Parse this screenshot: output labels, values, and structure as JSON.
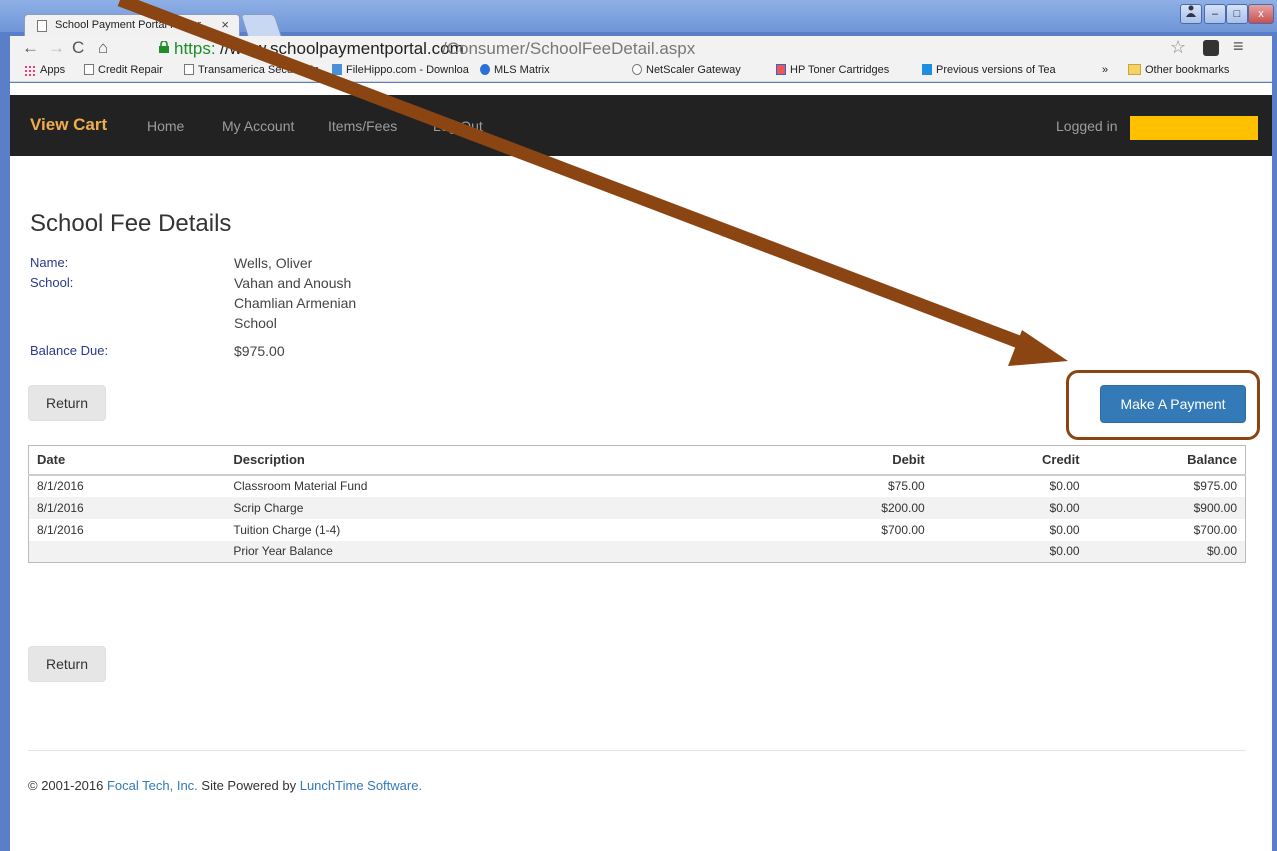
{
  "browser": {
    "tab_title": "School Payment Portal Power",
    "tab_close": "×",
    "url_scheme": "https:",
    "url_host": "//www.schoolpaymentportal.com",
    "url_path": "/Consumer/SchoolFeeDetail.aspx",
    "window_buttons": {
      "user": "👤",
      "minimize": "–",
      "maximize": "□",
      "close": "x"
    },
    "bookmarks": [
      {
        "label": "Apps",
        "icon": "apps-icon"
      },
      {
        "label": "Credit Repair",
        "icon": "page-icon"
      },
      {
        "label": "Transamerica Secure Em",
        "icon": "page-icon"
      },
      {
        "label": "FileHippo.com - Downloa",
        "icon": "filehippo-icon"
      },
      {
        "label": "MLS Matrix",
        "icon": "chrome-icon"
      },
      {
        "label": "NetScaler Gateway",
        "icon": "lock-icon"
      },
      {
        "label": "HP Toner Cartridges",
        "icon": "hp-icon"
      },
      {
        "label": "Previous versions of Tea",
        "icon": "teamviewer-icon"
      },
      {
        "label": "»",
        "icon": ""
      },
      {
        "label": "Other bookmarks",
        "icon": "folder-icon"
      }
    ]
  },
  "nav": {
    "brand": "View Cart",
    "links": [
      "Home",
      "My Account",
      "Items/Fees",
      "Log Out"
    ],
    "logged_in_label": "Logged in",
    "accent_color": "#f0ad4e"
  },
  "page": {
    "title": "School Fee Details",
    "name_label": "Name:",
    "name_value": "Wells, Oliver",
    "school_label": "School:",
    "school_value": "Vahan and Anoush Chamlian Armenian School",
    "balance_label": "Balance Due:",
    "balance_value": "$975.00",
    "return_label": "Return",
    "pay_label": "Make A Payment"
  },
  "table": {
    "headers": [
      "Date",
      "Description",
      "Debit",
      "Credit",
      "Balance"
    ],
    "rows": [
      [
        "8/1/2016",
        "Classroom Material Fund",
        "$75.00",
        "$0.00",
        "$975.00"
      ],
      [
        "8/1/2016",
        "Scrip Charge",
        "$200.00",
        "$0.00",
        "$900.00"
      ],
      [
        "8/1/2016",
        "Tuition Charge (1-4)",
        "$700.00",
        "$0.00",
        "$700.00"
      ],
      [
        "",
        "Prior Year Balance",
        "",
        "$0.00",
        "$0.00"
      ]
    ]
  },
  "footer": {
    "copyright": "© 2001-2016",
    "company": "Focal Tech, Inc.",
    "powered_text": "Site Powered by",
    "powered_link": "LunchTime Software."
  },
  "annotation": {
    "color": "#8b4513"
  }
}
